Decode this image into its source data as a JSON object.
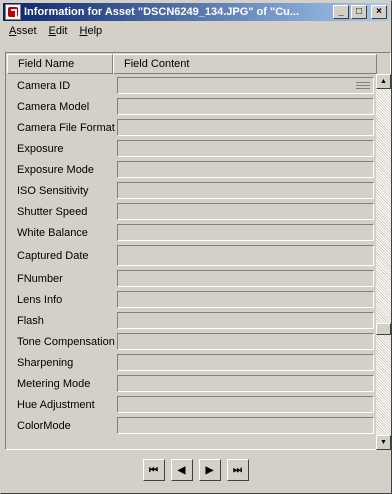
{
  "window": {
    "title": "Information for Asset \"DSCN6249_134.JPG\" of \"Cu...",
    "minimize_glyph": "_",
    "restore_glyph": "□",
    "close_glyph": "×"
  },
  "menu": [
    {
      "label": "Asset",
      "mnemonic": "A",
      "rest": "sset"
    },
    {
      "label": "Edit",
      "mnemonic": "E",
      "rest": "dit"
    },
    {
      "label": "Help",
      "mnemonic": "H",
      "rest": "elp"
    }
  ],
  "table": {
    "columns": [
      "Field Name",
      "Field Content"
    ],
    "rows": [
      {
        "name": "Camera ID",
        "value": ""
      },
      {
        "name": "Camera Model",
        "value": ""
      },
      {
        "name": "Camera File Format",
        "value": ""
      },
      {
        "name": "Exposure",
        "value": ""
      },
      {
        "name": "Exposure Mode",
        "value": ""
      },
      {
        "name": "ISO Sensitivity",
        "value": ""
      },
      {
        "name": "Shutter Speed",
        "value": ""
      },
      {
        "name": "White Balance",
        "value": ""
      },
      {
        "name": "Captured Date",
        "value": ""
      },
      {
        "name": "FNumber",
        "value": ""
      },
      {
        "name": "Lens Info",
        "value": ""
      },
      {
        "name": "Flash",
        "value": ""
      },
      {
        "name": "Tone Compensation",
        "value": ""
      },
      {
        "name": "Sharpening",
        "value": ""
      },
      {
        "name": "Metering Mode",
        "value": ""
      },
      {
        "name": "Hue Adjustment",
        "value": ""
      },
      {
        "name": "ColorMode",
        "value": ""
      }
    ]
  },
  "scrollbar": {
    "up_glyph": "▲",
    "down_glyph": "▼",
    "position_fraction": 0.7
  },
  "navigation": {
    "first_glyph": "⏮",
    "prev_glyph": "◀",
    "next_glyph": "▶",
    "last_glyph": "⏭"
  }
}
